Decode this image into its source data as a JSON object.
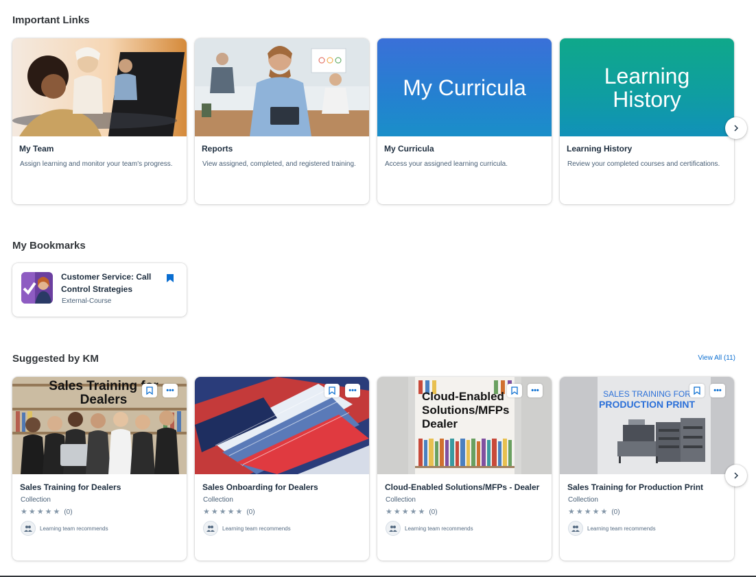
{
  "important_links": {
    "title": "Important Links",
    "cards": [
      {
        "title": "My Team",
        "desc": "Assign learning and monitor your team's progress."
      },
      {
        "title": "Reports",
        "desc": "View assigned, completed, and registered training."
      },
      {
        "title": "My Curricula",
        "desc": "Access your assigned learning curricula.",
        "thumb_text": "My Curricula"
      },
      {
        "title": "Learning History",
        "desc": "Review your completed courses and certifications.",
        "thumb_text": "Learning History"
      }
    ],
    "next_icon": "chevron-right-icon"
  },
  "bookmarks": {
    "title": "My Bookmarks",
    "item": {
      "title": "Customer Service: Call Control Strategies",
      "type": "External-Course",
      "icon": "bookmark-filled-icon"
    }
  },
  "suggested": {
    "title": "Suggested by KM",
    "view_all": "View All (11)",
    "cards": [
      {
        "title": "Sales Training for Dealers",
        "type": "Collection",
        "stars": "★★★★★",
        "count": "(0)",
        "rec": "Learning team recommends",
        "banner": "Sales Training for Dealers"
      },
      {
        "title": "Sales Onboarding for Dealers",
        "type": "Collection",
        "stars": "★★★★★",
        "count": "(0)",
        "rec": "Learning team recommends"
      },
      {
        "title": "Cloud-Enabled Solutions/MFPs - Dealer",
        "type": "Collection",
        "stars": "★★★★★",
        "count": "(0)",
        "rec": "Learning team recommends",
        "banner": "Cloud-Enabled Solutions/MFPs Dealer"
      },
      {
        "title": "Sales Training for Production Print",
        "type": "Collection",
        "stars": "★★★★★",
        "count": "(0)",
        "rec": "Learning team recommends",
        "banner_1": "SALES TRAINING FOR",
        "banner_2": "PRODUCTION PRINT"
      }
    ],
    "more_label": "•••"
  },
  "colors": {
    "accent": "#0a6ed1",
    "curricula_top": "#3a70d8",
    "curricula_bottom": "#1a8fc9",
    "history_top": "#0fa88a",
    "history_bottom": "#1191b9"
  }
}
